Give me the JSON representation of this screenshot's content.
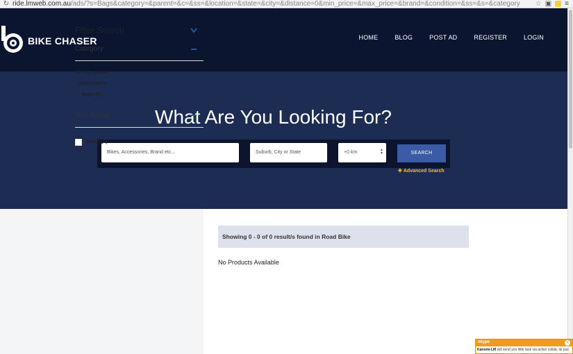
{
  "browser": {
    "url_host": "ride.lmweb.com.au",
    "url_path": "/ads/?s=Bags&category=&parent=&c=&ss=&location=&state=&city=&distance=0&min_price=&max_price=&brand=&condition=&ss=&s=&category=&parent=&c=&location=&sta"
  },
  "header": {
    "logo_text": "BIKE CHASER",
    "nav": [
      "HOME",
      "BLOG",
      "POST AD",
      "REGISTER",
      "LOGIN"
    ]
  },
  "hero": {
    "title": "What Are You Looking For?",
    "keyword_placeholder": "Bikes, Accessories, Brand etc...",
    "location_placeholder": "Suburb, City or State",
    "distance_value": "+0 km",
    "search_label": "SEARCH",
    "advanced_label": "Advanced Search"
  },
  "sidebar": {
    "filter_title": "Filter Search",
    "category_title": "Category",
    "all_categories": "All Categories",
    "accessories": "Accessories",
    "bags": "Bags (0)",
    "brand_title": "Bike Brand",
    "basso": "Basso (2)"
  },
  "results": {
    "summary": "Showing 0 - 0 of 0 result/s found in Road Bike",
    "empty": "No Products Available"
  },
  "chat": {
    "app": "skype",
    "sender": "Kanomi-LM",
    "message": "will send you little task via active collab, its just"
  },
  "colors": {
    "header_bg": "#0b1530",
    "hero_bg": "#1c2c53",
    "button": "#3b5ba6",
    "accent": "#f2c029"
  }
}
